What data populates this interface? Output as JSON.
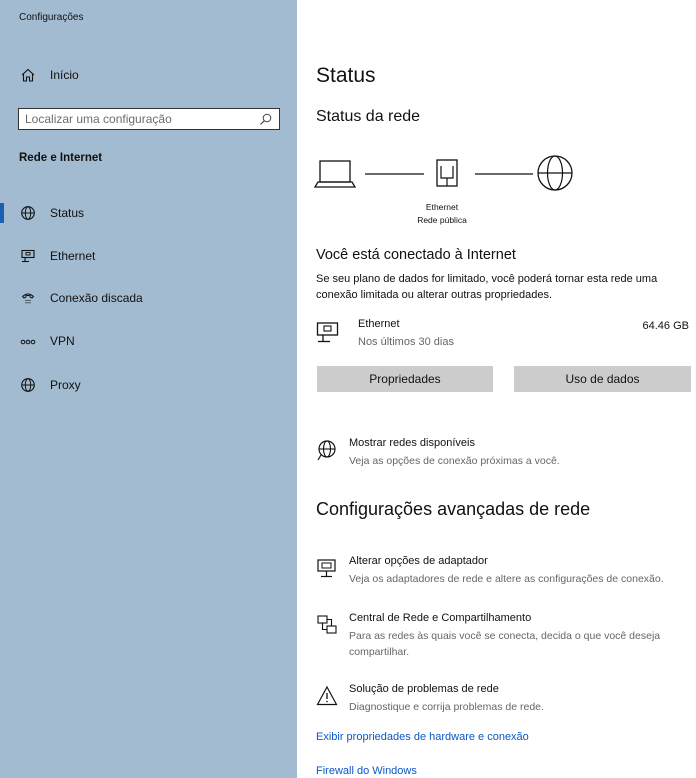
{
  "app": {
    "title": "Configurações"
  },
  "sidebar": {
    "home_label": "Início",
    "search_placeholder": "Localizar uma configuração",
    "section_title": "Rede e Internet",
    "items": [
      {
        "label": "Status",
        "icon": "globe-icon",
        "selected": true
      },
      {
        "label": "Ethernet",
        "icon": "ethernet-icon",
        "selected": false
      },
      {
        "label": "Conexão discada",
        "icon": "dialup-icon",
        "selected": false
      },
      {
        "label": "VPN",
        "icon": "vpn-icon",
        "selected": false
      },
      {
        "label": "Proxy",
        "icon": "globe-icon",
        "selected": false
      }
    ]
  },
  "main": {
    "title": "Status",
    "network_status_title": "Status da rede",
    "diagram": {
      "adapter_label": "Ethernet",
      "network_label": "Rede pública"
    },
    "connected_title": "Você está conectado à Internet",
    "connected_desc": "Se seu plano de dados for limitado, você poderá tornar esta rede uma conexão limitada ou alterar outras propriedades.",
    "connection": {
      "name": "Ethernet",
      "period": "Nos últimos 30 dias",
      "usage": "64.46 GB"
    },
    "buttons": {
      "properties": "Propriedades",
      "data_usage": "Uso de dados"
    },
    "show_networks": {
      "title": "Mostrar redes disponíveis",
      "desc": "Veja as opções de conexão próximas a você."
    },
    "advanced_title": "Configurações avançadas de rede",
    "advanced_items": [
      {
        "title": "Alterar opções de adaptador",
        "desc": [
          "Veja os adaptadores de rede e altere as configurações de conexão."
        ],
        "icon": "adapter-icon"
      },
      {
        "title": "Central de Rede e Compartilhamento",
        "desc": [
          "Para as redes às quais você se conecta, decida o que você deseja",
          "compartilhar."
        ],
        "icon": "network-sharing-icon"
      },
      {
        "title": "Solução de problemas de rede",
        "desc": [
          "Diagnostique e corrija problemas de rede."
        ],
        "icon": "warning-icon"
      }
    ],
    "links": {
      "hardware_properties": "Exibir propriedades de hardware e conexão",
      "firewall": "Firewall do Windows"
    }
  },
  "colors": {
    "sidebar_bg": "#a3bbd0",
    "accent": "#1a5fb4",
    "link": "#0a58c8",
    "button_bg": "#cccccc"
  }
}
